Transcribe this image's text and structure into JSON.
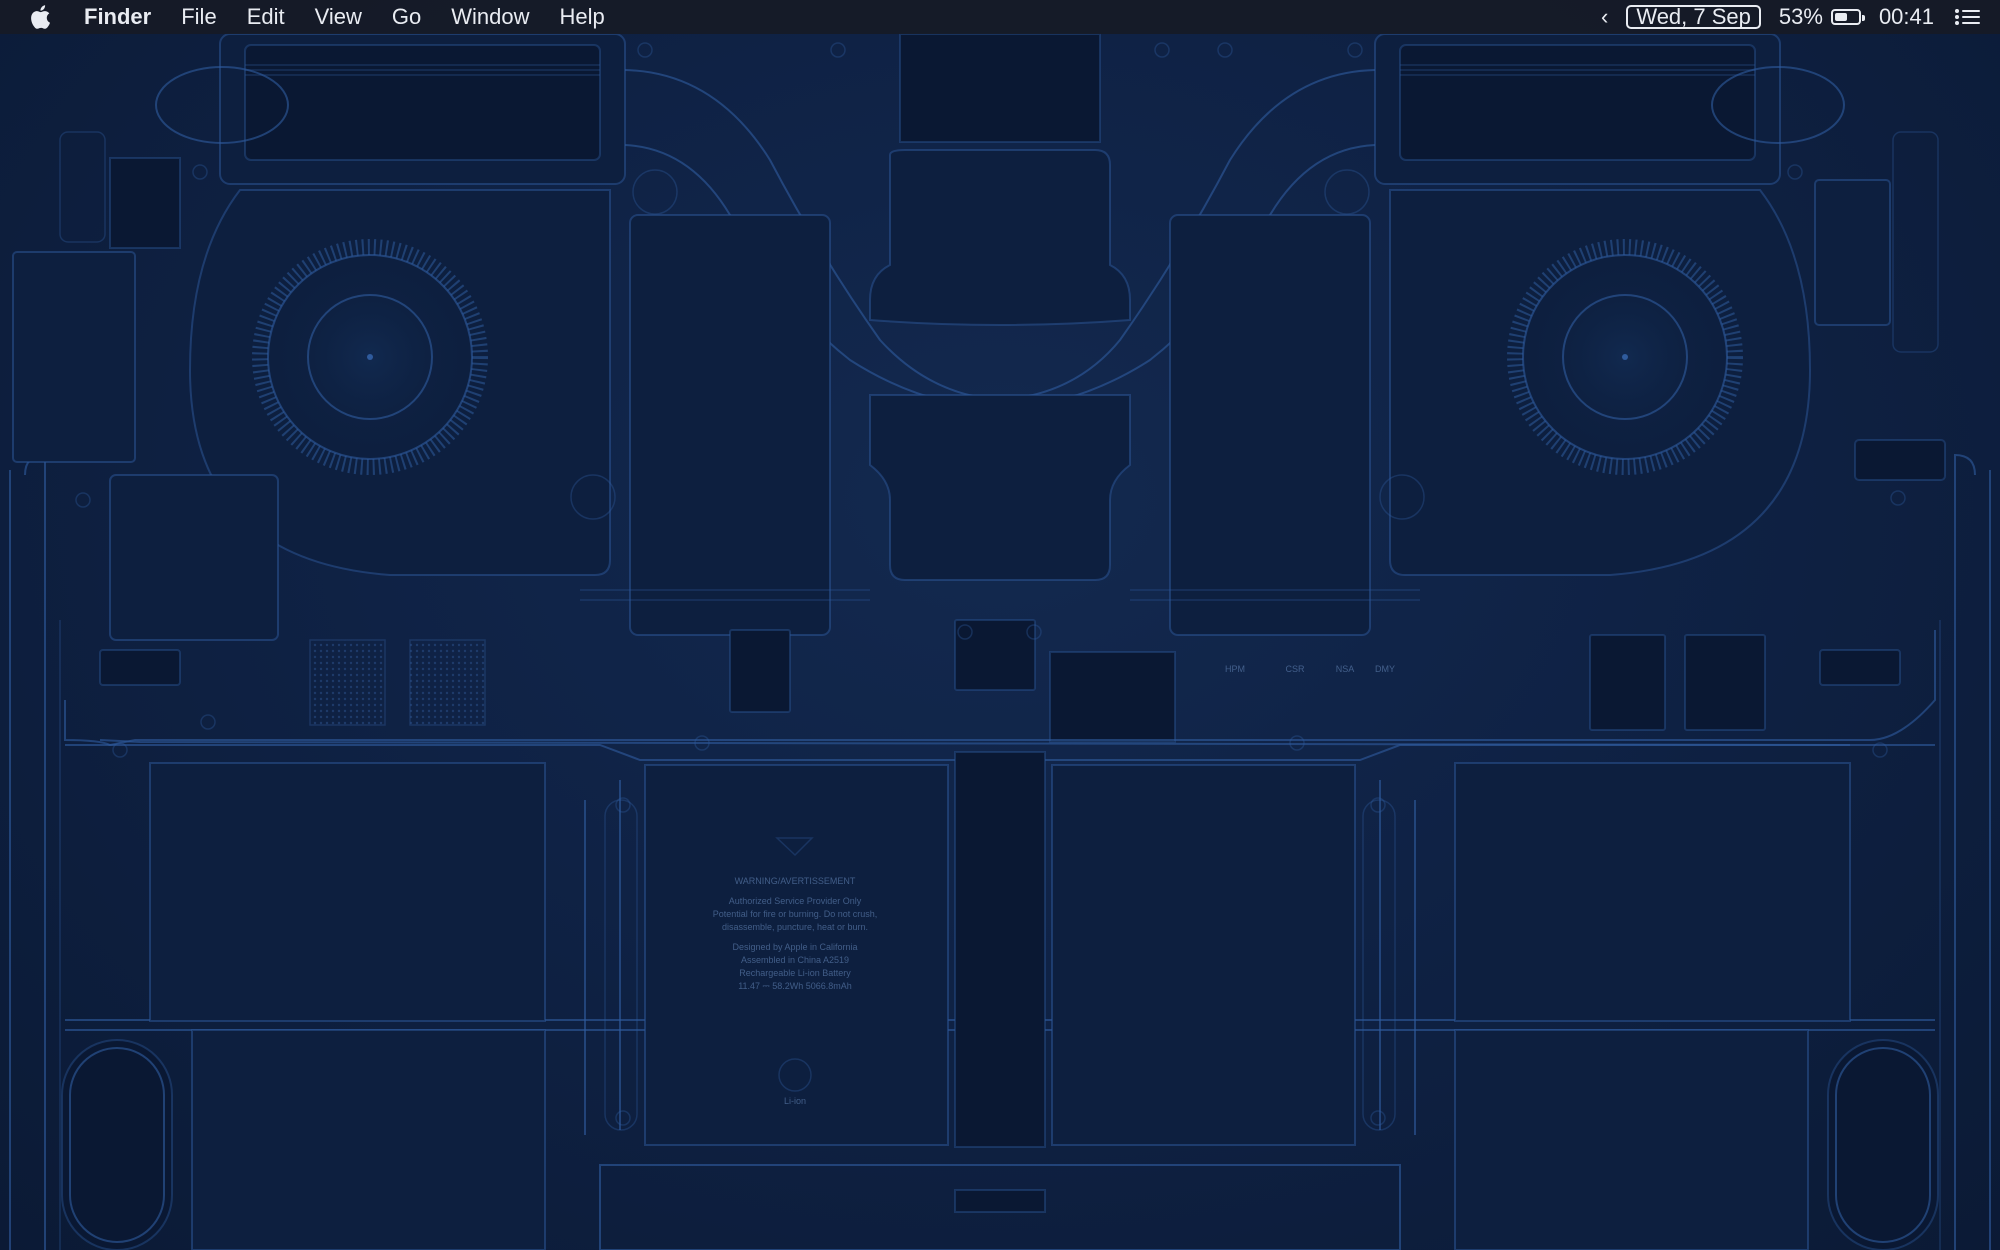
{
  "menu": {
    "app_name": "Finder",
    "items": [
      "File",
      "Edit",
      "View",
      "Go",
      "Window",
      "Help"
    ]
  },
  "status": {
    "date": "Wed, 7 Sep",
    "battery_percent": "53%",
    "battery_level": 0.53,
    "time": "00:41",
    "chevron": "‹"
  },
  "wallpaper": {
    "battery_label": [
      "WARNING/AVERTISSEMENT",
      "Authorized Service Provider Only",
      "Potential for fire or burning. Do not crush,",
      "disassemble, puncture, heat or burn.",
      "Designed by Apple in California",
      "Assembled in China A2519",
      "Rechargeable Li-ion Battery",
      "11.47 ⎓ 58.2Wh 5066.8mAh",
      "Li-ion"
    ],
    "chip_marks": [
      "HPM",
      "CSR",
      "NSA",
      "DMY"
    ]
  },
  "icons": {
    "apple": "apple-logo-icon",
    "battery": "battery-icon",
    "control_center": "control-center-icon",
    "chevron": "chevron-left-icon"
  },
  "colors": {
    "menubar": "#161b26",
    "background": "#0f2245",
    "line": "#2f5b9d"
  }
}
